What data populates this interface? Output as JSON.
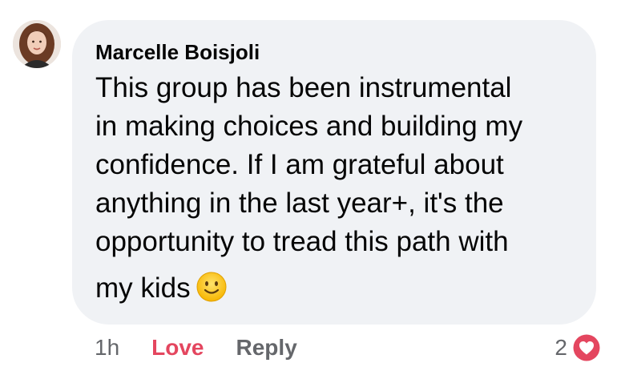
{
  "comment": {
    "author": "Marcelle Boisjoli",
    "text_lines": [
      "This group has been instrumental",
      "in making choices and building my",
      "confidence. If I am grateful about",
      "anything in the last year+, it's the",
      "opportunity to tread this path with",
      "my kids"
    ],
    "emoji": "slightly-smiling-face"
  },
  "actions": {
    "timestamp": "1h",
    "love_label": "Love",
    "reply_label": "Reply"
  },
  "reactions": {
    "count": "2",
    "type": "love-heart-icon",
    "color": "#e4465f"
  },
  "colors": {
    "bubble_background": "#f0f2f5",
    "text": "#050505",
    "secondary_text": "#65676b",
    "love_accent": "#e4465f"
  }
}
